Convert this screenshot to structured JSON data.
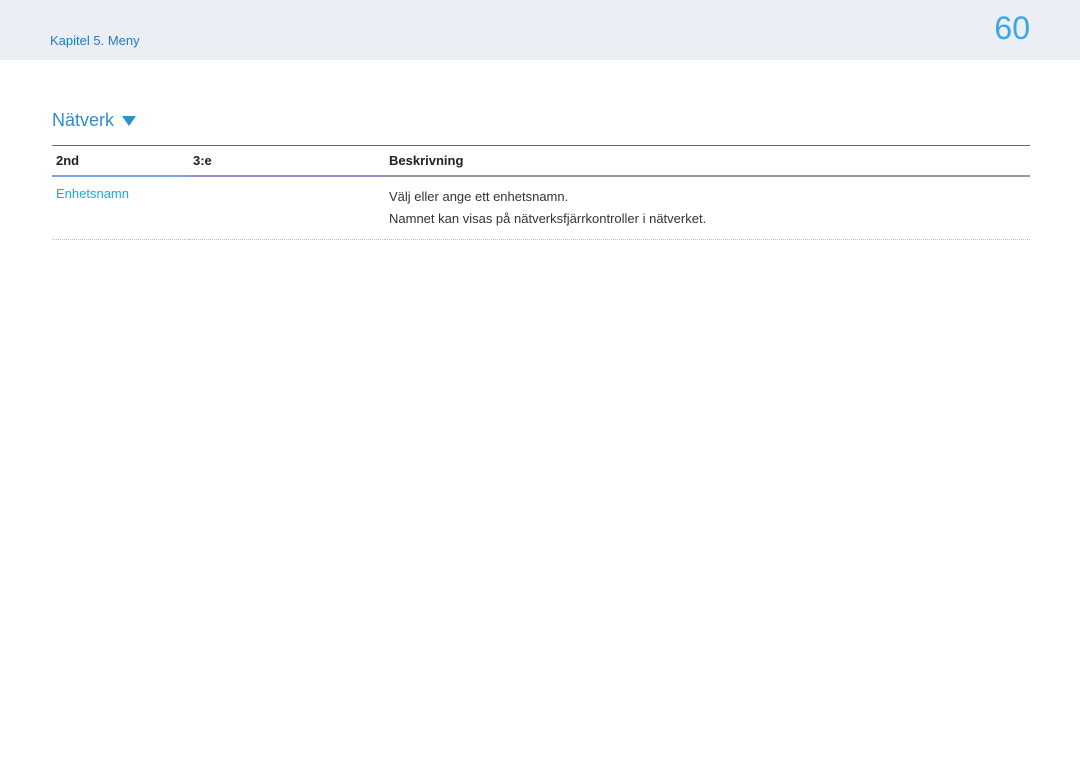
{
  "header": {
    "breadcrumb": "Kapitel 5. Meny",
    "page_number": "60"
  },
  "section": {
    "title": "Nätverk"
  },
  "table": {
    "headers": {
      "col1": "2nd",
      "col2": "3:e",
      "col3": "Beskrivning"
    },
    "rows": [
      {
        "col1": "Enhetsnamn",
        "col2": "",
        "desc_line1": "Välj eller ange ett enhetsnamn.",
        "desc_line2": "Namnet kan visas på nätverksfjärrkontroller i nätverket."
      }
    ]
  }
}
